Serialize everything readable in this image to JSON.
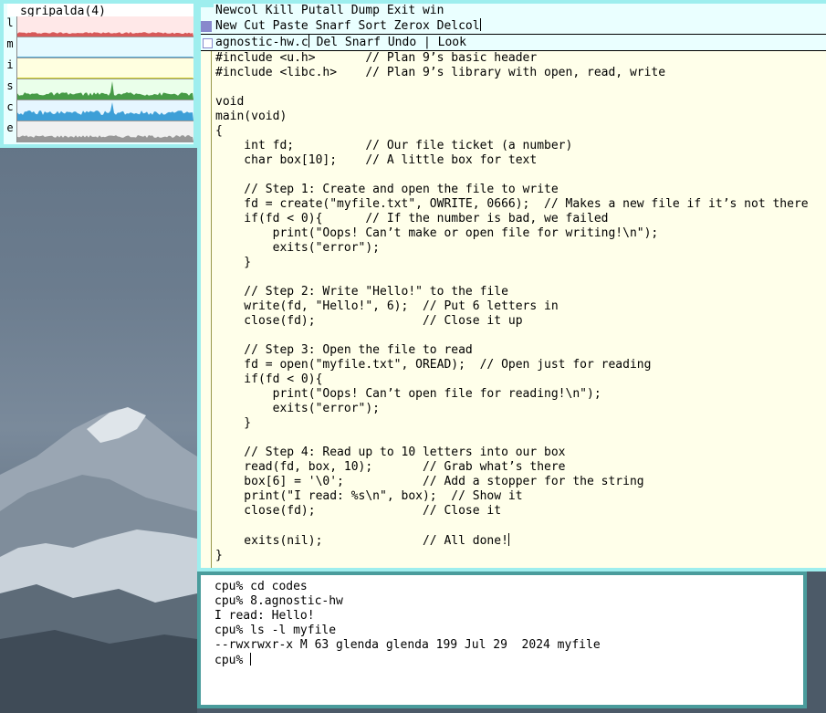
{
  "stats": {
    "title": "sgripalda(4)",
    "rows": [
      {
        "label": "l",
        "color": "#d04040",
        "bg": "#ffe8e8"
      },
      {
        "label": "m",
        "color": "#40a0d0",
        "bg": "#e6faff"
      },
      {
        "label": "i",
        "color": "#c8c800",
        "bg": "#ffffe0"
      },
      {
        "label": "s",
        "color": "#2a8a2a",
        "bg": "#eaffea"
      },
      {
        "label": "c",
        "color": "#1f8fd0",
        "bg": "#e6f6ff"
      },
      {
        "label": "e",
        "color": "#888888",
        "bg": "#f0f0f0"
      }
    ]
  },
  "acme": {
    "column_tag": "Newcol Kill Putall Dump Exit win",
    "window_tag": "New Cut Paste Snarf Sort Zerox Delcol",
    "file_name": "agnostic-hw.c",
    "file_tag_cmds": " Del Snarf Undo | Look",
    "code_lines": [
      "#include <u.h>       // Plan 9’s basic header",
      "#include <libc.h>    // Plan 9’s library with open, read, write",
      "",
      "void",
      "main(void)",
      "{",
      "    int fd;          // Our file ticket (a number)",
      "    char box[10];    // A little box for text",
      "",
      "    // Step 1: Create and open the file to write",
      "    fd = create(\"myfile.txt\", OWRITE, 0666);  // Makes a new file if it’s not there",
      "    if(fd < 0){      // If the number is bad, we failed",
      "        print(\"Oops! Can’t make or open file for writing!\\n\");",
      "        exits(\"error\");",
      "    }",
      "",
      "    // Step 2: Write \"Hello!\" to the file",
      "    write(fd, \"Hello!\", 6);  // Put 6 letters in",
      "    close(fd);               // Close it up",
      "",
      "    // Step 3: Open the file to read",
      "    fd = open(\"myfile.txt\", OREAD);  // Open just for reading",
      "    if(fd < 0){",
      "        print(\"Oops! Can’t open file for reading!\\n\");",
      "        exits(\"error\");",
      "    }",
      "",
      "    // Step 4: Read up to 10 letters into our box",
      "    read(fd, box, 10);       // Grab what’s there",
      "    box[6] = '\\0';           // Add a stopper for the string",
      "    print(\"I read: %s\\n\", box);  // Show it",
      "    close(fd);               // Close it",
      "",
      "    exits(nil);              // All done!",
      "}"
    ]
  },
  "terminal": {
    "lines": [
      "cpu% cd codes",
      "cpu% 8.agnostic-hw",
      "I read: Hello!",
      "cpu% ls -l myfile",
      "--rwxrwxr-x M 63 glenda glenda 199 Jul 29  2024 myfile",
      "cpu% "
    ]
  }
}
